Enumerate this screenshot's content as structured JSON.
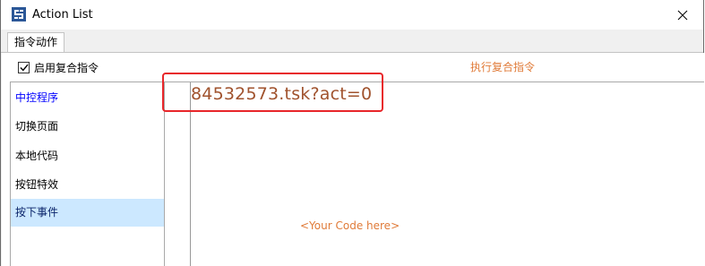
{
  "window": {
    "title": "Action List",
    "app_icon": "app-logo-icon",
    "close_icon": "close-icon"
  },
  "tabs": [
    {
      "label": "指令动作",
      "selected": true
    }
  ],
  "options": {
    "composite_checkbox_label": "启用复合指令",
    "composite_checked": true,
    "execute_label": "执行复合指令"
  },
  "sidebar": {
    "items": [
      {
        "label": "中控程序",
        "state": "active"
      },
      {
        "label": "切换页面",
        "state": "normal"
      },
      {
        "label": "本地代码",
        "state": "normal"
      },
      {
        "label": "按钮特效",
        "state": "normal"
      },
      {
        "label": "按下事件",
        "state": "selected"
      }
    ]
  },
  "editor": {
    "code": "84532573.tsk?act=0",
    "placeholder": "<Your Code here>"
  },
  "colors": {
    "accent_orange": "#e07b39",
    "code_brown": "#a0522d",
    "selected_bg": "#cce8ff",
    "active_blue": "#0000ff",
    "annotation_red": "#e8262a"
  }
}
